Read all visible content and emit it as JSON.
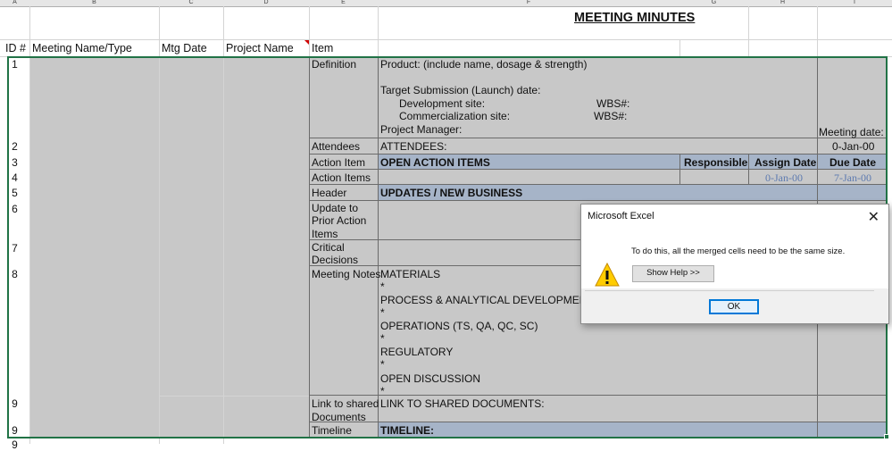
{
  "app": {
    "window_title": "Microsoft Excel"
  },
  "columns": [
    "A",
    "B",
    "C",
    "D",
    "E",
    "F",
    "G",
    "H",
    "I"
  ],
  "sheet": {
    "title": "MEETING MINUTES",
    "headers": {
      "id": "ID #",
      "meeting_name": "Meeting Name/Type",
      "mtg_date": "Mtg Date",
      "project_name": "Project Name",
      "item": "Item"
    },
    "row_numbers": [
      "1",
      "2",
      "3",
      "4",
      "5",
      "6",
      "7",
      "8",
      "9",
      "9",
      "9"
    ],
    "items": {
      "definition": "Definition",
      "attendees": "Attendees",
      "action_item": "Action Item",
      "action_items": "Action Items",
      "header": "Header",
      "update_1": "Update to",
      "update_2": "Prior Action",
      "update_3": "Items",
      "critical_1": "Critical",
      "critical_2": "Decisions",
      "meeting_notes": "Meeting Notes",
      "link_1": "Link to shared",
      "link_2": "Documents",
      "timeline": "Timeline"
    },
    "definition_block": {
      "product": "Product:  (include name, dosage & strength)",
      "target_submission": "Target Submission (Launch) date:",
      "development_site": "Development site:",
      "wbs_1": "WBS#:",
      "commercialization_site": "Commercialization site:",
      "wbs_2": "WBS#:",
      "project_manager": "Project Manager:",
      "meeting_date_label": "Meeting date:"
    },
    "attendees_label": "ATTENDEES:",
    "attendees_date": "0-Jan-00",
    "open_action_items": "OPEN ACTION ITEMS",
    "responsible": "Responsible",
    "assign_date": "Assign Date",
    "due_date": "Due Date",
    "assign_date_value": "0-Jan-00",
    "due_date_value": "7-Jan-00",
    "updates_header": "UPDATES / NEW BUSINESS",
    "notes": {
      "materials": "MATERIALS",
      "process": "PROCESS & ANALYTICAL DEVELOPMENT",
      "operations": "OPERATIONS (TS, QA, QC, SC)",
      "regulatory": "REGULATORY",
      "open_discussion": "OPEN DISCUSSION",
      "bullet": "*"
    },
    "link_shared": "LINK TO SHARED DOCUMENTS:",
    "timeline_header": "TIMELINE:"
  },
  "dialog": {
    "title": "Microsoft Excel",
    "message": "To do this, all the merged cells need to be the same size.",
    "help_button": "Show Help >>",
    "ok_button": "OK",
    "icon": "warning-icon"
  },
  "colors": {
    "cell_gray": "#c8c8c8",
    "header_blue": "#a6b4c8",
    "link_date": "#5d7ab0",
    "selection_green": "#217346"
  }
}
